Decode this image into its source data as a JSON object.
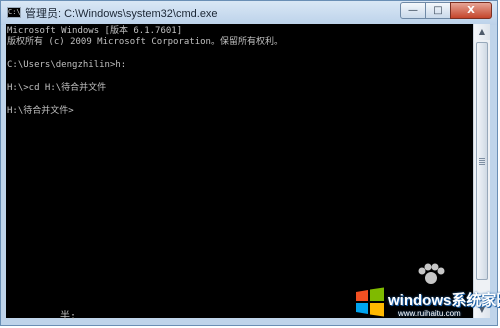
{
  "window": {
    "title": "管理员: C:\\Windows\\system32\\cmd.exe",
    "icon": "cmd-icon",
    "buttons": {
      "minimize": "—",
      "maximize": "□",
      "close": "X"
    }
  },
  "console": {
    "lines": [
      "Microsoft Windows [版本 6.1.7601]",
      "版权所有 (c) 2009 Microsoft Corporation。保留所有权利。",
      "",
      "C:\\Users\\dengzhilin>h:",
      "",
      "H:\\>cd H:\\待合并文件",
      "",
      "H:\\待合并文件>"
    ]
  },
  "status": {
    "ime_text": "半:"
  },
  "scrollbar": {
    "up_arrow": "▲",
    "down_arrow": "▼"
  },
  "watermark": {
    "text": "windows系统家园",
    "sub": "www.ruihaitu.com"
  }
}
